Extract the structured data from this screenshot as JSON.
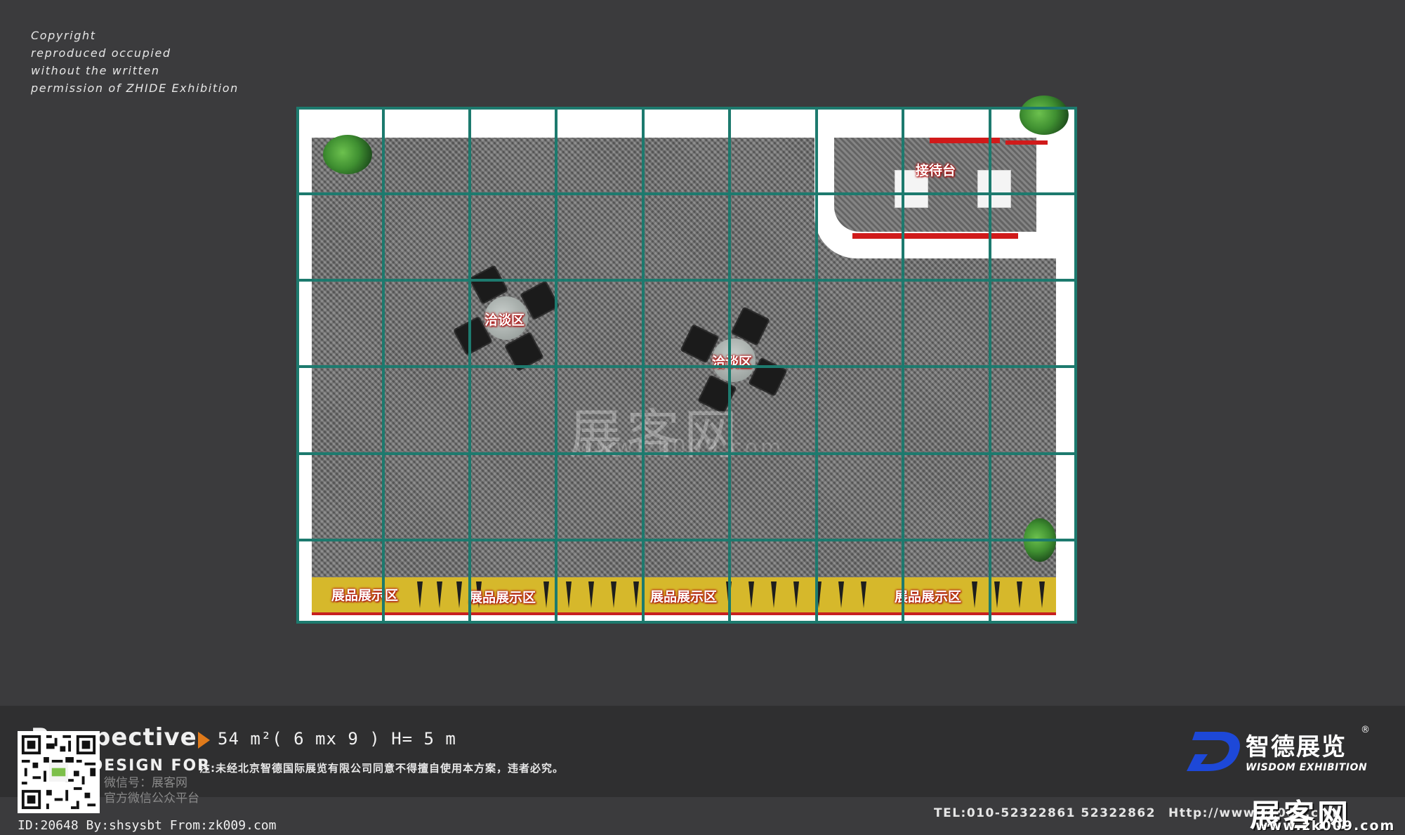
{
  "copyright": {
    "lines": [
      "Copyright",
      "reproduced occupied",
      "without the written",
      "permission of ZHIDE Exhibition"
    ]
  },
  "plan": {
    "labels": {
      "reception": "接待台",
      "negotiation_1": "洽谈区",
      "negotiation_2": "洽谈区",
      "display_1": "展品展示区",
      "display_2": "展品展示区",
      "display_3": "展品展示区",
      "display_4": "展品展示区"
    },
    "watermark": {
      "text": "展客网",
      "url": "www.zk009.com"
    },
    "colors": {
      "grid": "#1d7a6e",
      "accent_red": "#d01a1a",
      "display_yellow": "#d6b82b"
    }
  },
  "info": {
    "title": "Perspective",
    "design_for": "DESIGN FOR",
    "spec": "54 m²( 6  mx  9   )  H= 5 m",
    "notice": "注:未经北京智德国际展览有限公司同意不得擅自使用本方案，违者必究。",
    "wechat_line1": "微信号：展客网",
    "wechat_line2": "官方微信公众平台",
    "brand_cn": "智德展览",
    "brand_reg": "®",
    "brand_en": "WISDOM EXHIBITION",
    "tel": "TEL:010-52322861   52322862",
    "url": "Http://www.zk009.com",
    "zk_logo": "展客网",
    "zk_url": "www.zk009.com",
    "id_line": "ID:20648 By:shsysbt From:zk009.com"
  },
  "icons": {
    "arrow": "play-arrow-icon",
    "qr": "qr-code-icon",
    "brand": "brand-d-logo-icon"
  }
}
